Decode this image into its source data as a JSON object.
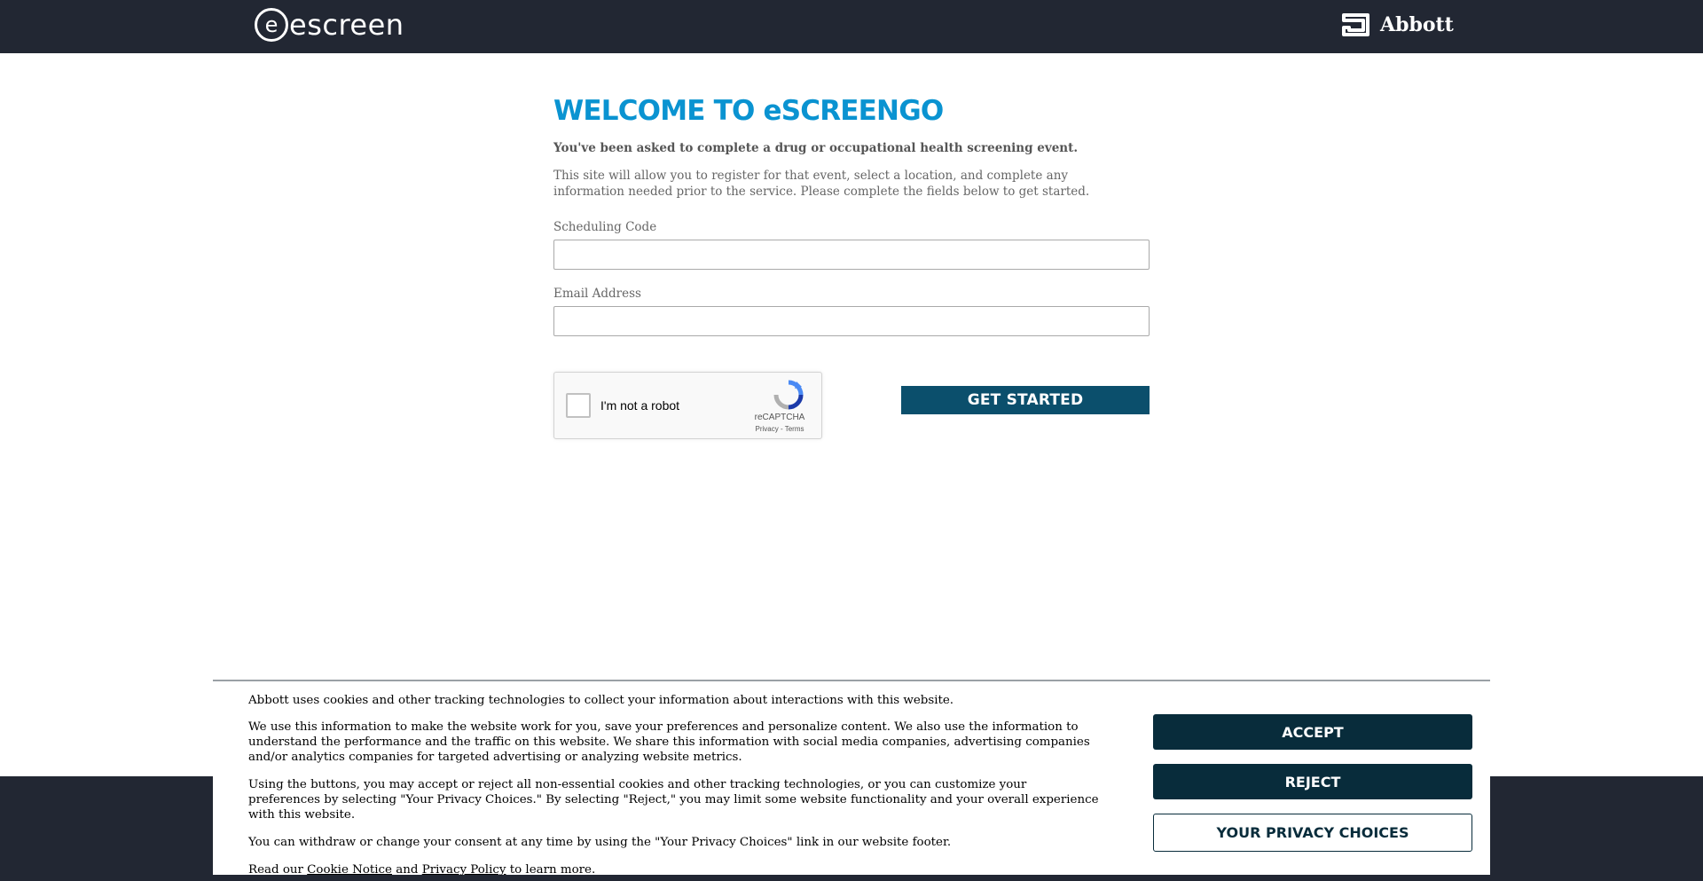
{
  "header": {
    "brand": "escreen",
    "brand_mark": "e",
    "partner": "Abbott",
    "partner_icon": "abbott-logo-icon"
  },
  "main": {
    "title": "WELCOME TO eSCREENGO",
    "lead": "You've been asked to complete a drug or occupational health screening event.",
    "description": "This site will allow you to register for that event, select a location, and complete any information needed prior to the service. Please complete the fields below to get started.",
    "scheduling_code": {
      "label": "Scheduling Code",
      "value": "",
      "placeholder": ""
    },
    "email": {
      "label": "Email Address",
      "value": "",
      "placeholder": ""
    },
    "recaptcha": {
      "checkbox_label": "I'm not a robot",
      "brand": "reCAPTCHA",
      "links": "Privacy - Terms",
      "checked": false,
      "icon": "recaptcha-logo-icon"
    },
    "submit_label": "GET STARTED"
  },
  "cookie_banner": {
    "p1": "Abbott uses cookies and other tracking technologies to collect your information about interactions with this website.",
    "p2": "We use this information to make the website work for you, save your preferences and personalize content. We also use the information to understand the performance and the traffic on this website. We share this information with social media companies, advertising companies and/or analytics companies for targeted advertising or analyzing website metrics.",
    "p3": "Using the buttons, you may accept or reject all non-essential cookies and other tracking technologies, or you can customize your preferences by selecting \"Your Privacy Choices.\" By selecting \"Reject,\" you may limit some website functionality and your overall experience with this website.",
    "p4": "You can withdraw or change your consent at any time by using the \"Your Privacy Choices\" link in our website footer.",
    "p5_prefix": "Read our",
    "cookie_notice_link": "Cookie Notice",
    "p5_and": "and",
    "privacy_policy_link": "Privacy Policy",
    "p5_suffix": "to learn more.",
    "accept_label": "ACCEPT",
    "reject_label": "REJECT",
    "privacy_choices_label": "YOUR PRIVACY CHOICES"
  },
  "colors": {
    "header_bg": "#222733",
    "title": "#0a93d1",
    "primary_button": "#0b4f6c",
    "cookie_button": "#082c3b"
  }
}
